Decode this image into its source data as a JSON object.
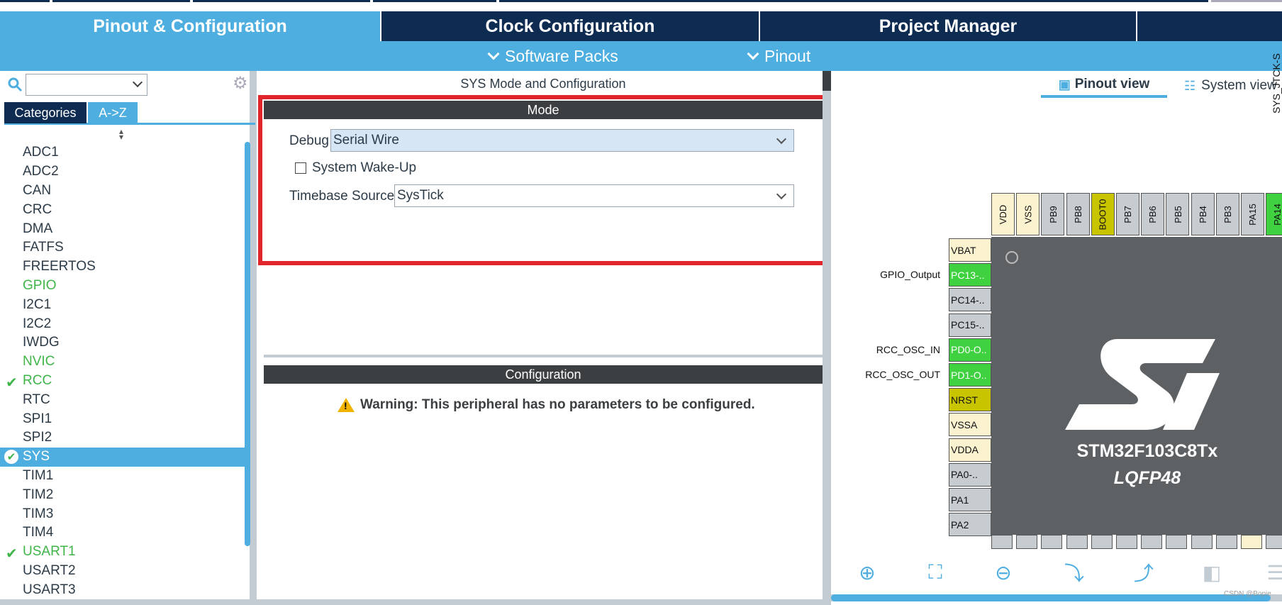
{
  "main_tabs": [
    "Pinout & Configuration",
    "Clock Configuration",
    "Project Manager",
    ""
  ],
  "sub_menu": {
    "software_packs": "Software Packs",
    "pinout": "Pinout"
  },
  "left": {
    "search_value": "",
    "category_tabs": [
      "Categories",
      "A->Z"
    ],
    "peripherals": [
      {
        "label": "ADC1",
        "state": "normal"
      },
      {
        "label": "ADC2",
        "state": "normal"
      },
      {
        "label": "CAN",
        "state": "normal"
      },
      {
        "label": "CRC",
        "state": "normal"
      },
      {
        "label": "DMA",
        "state": "normal"
      },
      {
        "label": "FATFS",
        "state": "normal"
      },
      {
        "label": "FREERTOS",
        "state": "normal"
      },
      {
        "label": "GPIO",
        "state": "green"
      },
      {
        "label": "I2C1",
        "state": "normal"
      },
      {
        "label": "I2C2",
        "state": "normal"
      },
      {
        "label": "IWDG",
        "state": "normal"
      },
      {
        "label": "NVIC",
        "state": "green"
      },
      {
        "label": "RCC",
        "state": "checked"
      },
      {
        "label": "RTC",
        "state": "normal"
      },
      {
        "label": "SPI1",
        "state": "normal"
      },
      {
        "label": "SPI2",
        "state": "normal"
      },
      {
        "label": "SYS",
        "state": "selected"
      },
      {
        "label": "TIM1",
        "state": "normal"
      },
      {
        "label": "TIM2",
        "state": "normal"
      },
      {
        "label": "TIM3",
        "state": "normal"
      },
      {
        "label": "TIM4",
        "state": "normal"
      },
      {
        "label": "USART1",
        "state": "checked"
      },
      {
        "label": "USART2",
        "state": "normal"
      },
      {
        "label": "USART3",
        "state": "normal"
      }
    ]
  },
  "mid": {
    "title": "SYS Mode and Configuration",
    "mode_header": "Mode",
    "debug_label": "Debug",
    "debug_value": "Serial Wire",
    "wakeup_label": "System Wake-Up",
    "timebase_label": "Timebase Source",
    "timebase_value": "SysTick",
    "config_header": "Configuration",
    "warning": "Warning: This peripheral has no parameters to be configured."
  },
  "right": {
    "pinout_view": "Pinout view",
    "system_view": "System view",
    "top_pins": [
      {
        "label": "VDD",
        "color": "y"
      },
      {
        "label": "VSS",
        "color": "y"
      },
      {
        "label": "PB9",
        "color": "n"
      },
      {
        "label": "PB8",
        "color": "n"
      },
      {
        "label": "BOOT0",
        "color": "o"
      },
      {
        "label": "PB7",
        "color": "n"
      },
      {
        "label": "PB6",
        "color": "n"
      },
      {
        "label": "PB5",
        "color": "n"
      },
      {
        "label": "PB4",
        "color": "n"
      },
      {
        "label": "PB3",
        "color": "n"
      },
      {
        "label": "PA15",
        "color": "n"
      },
      {
        "label": "PA14",
        "color": "g"
      }
    ],
    "left_pins": [
      {
        "label": "VBAT",
        "color": "y",
        "signal": ""
      },
      {
        "label": "PC13-..",
        "color": "g",
        "signal": "GPIO_Output"
      },
      {
        "label": "PC14-..",
        "color": "n",
        "signal": ""
      },
      {
        "label": "PC15-..",
        "color": "n",
        "signal": ""
      },
      {
        "label": "PD0-O..",
        "color": "g",
        "signal": "RCC_OSC_IN"
      },
      {
        "label": "PD1-O..",
        "color": "g",
        "signal": "RCC_OSC_OUT"
      },
      {
        "label": "NRST",
        "color": "o",
        "signal": ""
      },
      {
        "label": "VSSA",
        "color": "y",
        "signal": ""
      },
      {
        "label": "VDDA",
        "color": "y",
        "signal": ""
      },
      {
        "label": "PA0-..",
        "color": "n",
        "signal": ""
      },
      {
        "label": "PA1",
        "color": "n",
        "signal": ""
      },
      {
        "label": "PA2",
        "color": "n",
        "signal": ""
      }
    ],
    "top_signal": "SYS_JTCK-S",
    "chip_name": "STM32F103C8Tx",
    "chip_package": "LQFP48",
    "watermark": "CSDN @Bopie"
  },
  "colors": {
    "navy": "#0e2b52",
    "blue": "#4eaee0",
    "green": "#3fb549",
    "red": "#e0262a"
  }
}
